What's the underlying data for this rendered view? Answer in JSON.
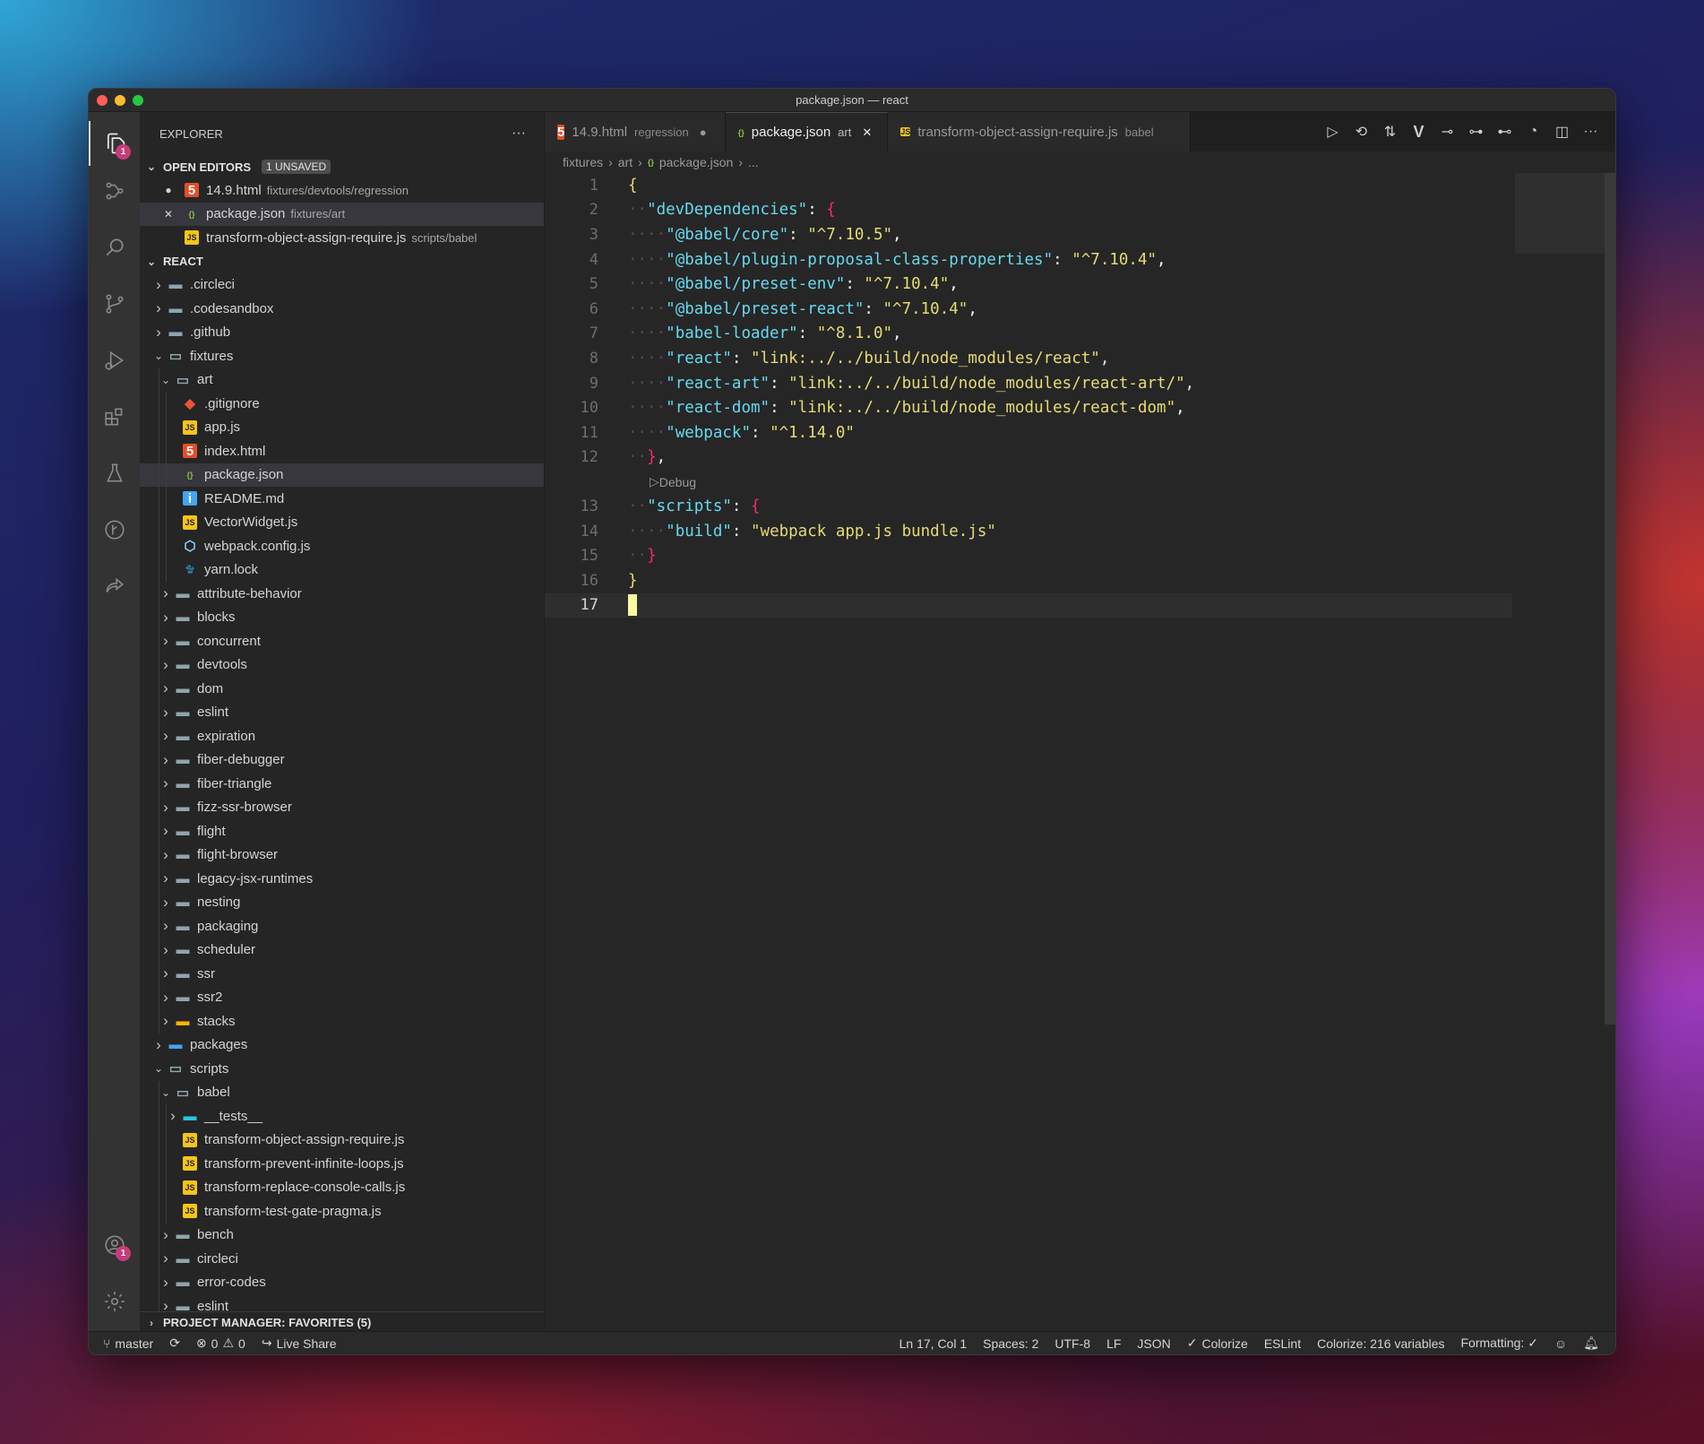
{
  "window": {
    "title": "package.json — react"
  },
  "sidebar": {
    "title": "EXPLORER",
    "more": "···",
    "open_editors": {
      "label": "OPEN EDITORS",
      "badge": "1 UNSAVED",
      "items": [
        {
          "name": "14.9.html",
          "desc": "fixtures/devtools/regression",
          "icon": "html5-icon",
          "state": "unsaved"
        },
        {
          "name": "package.json",
          "desc": "fixtures/art",
          "icon": "json-file-icon",
          "state": "close"
        },
        {
          "name": "transform-object-assign-require.js",
          "desc": "scripts/babel",
          "icon": "js-file-icon",
          "state": ""
        }
      ]
    },
    "react_label": "REACT",
    "tree": [
      {
        "name": ".circleci",
        "depth": 1,
        "type": "folder",
        "open": false,
        "icon": "circleci-folder-icon"
      },
      {
        "name": ".codesandbox",
        "depth": 1,
        "type": "folder",
        "open": false,
        "icon": "folder-icon"
      },
      {
        "name": ".github",
        "depth": 1,
        "type": "folder",
        "open": false,
        "icon": "github-folder-icon"
      },
      {
        "name": "fixtures",
        "depth": 1,
        "type": "folder",
        "open": true,
        "icon": "folder-open-icon"
      },
      {
        "name": "art",
        "depth": 2,
        "type": "folder",
        "open": true,
        "icon": "folder-open-icon"
      },
      {
        "name": ".gitignore",
        "depth": 3,
        "type": "file",
        "icon": "git-icon"
      },
      {
        "name": "app.js",
        "depth": 3,
        "type": "file",
        "icon": "js-file-icon"
      },
      {
        "name": "index.html",
        "depth": 3,
        "type": "file",
        "icon": "html5-icon"
      },
      {
        "name": "package.json",
        "depth": 3,
        "type": "file",
        "icon": "json-file-icon",
        "selected": true
      },
      {
        "name": "README.md",
        "depth": 3,
        "type": "file",
        "icon": "info-icon"
      },
      {
        "name": "VectorWidget.js",
        "depth": 3,
        "type": "file",
        "icon": "js-file-icon"
      },
      {
        "name": "webpack.config.js",
        "depth": 3,
        "type": "file",
        "icon": "webpack-icon"
      },
      {
        "name": "yarn.lock",
        "depth": 3,
        "type": "file",
        "icon": "yarn-icon"
      },
      {
        "name": "attribute-behavior",
        "depth": 2,
        "type": "folder",
        "open": false,
        "icon": "folder-icon"
      },
      {
        "name": "blocks",
        "depth": 2,
        "type": "folder",
        "open": false,
        "icon": "folder-icon"
      },
      {
        "name": "concurrent",
        "depth": 2,
        "type": "folder",
        "open": false,
        "icon": "folder-icon"
      },
      {
        "name": "devtools",
        "depth": 2,
        "type": "folder",
        "open": false,
        "icon": "folder-icon"
      },
      {
        "name": "dom",
        "depth": 2,
        "type": "folder",
        "open": false,
        "icon": "folder-icon"
      },
      {
        "name": "eslint",
        "depth": 2,
        "type": "folder",
        "open": false,
        "icon": "folder-icon"
      },
      {
        "name": "expiration",
        "depth": 2,
        "type": "folder",
        "open": false,
        "icon": "folder-icon"
      },
      {
        "name": "fiber-debugger",
        "depth": 2,
        "type": "folder",
        "open": false,
        "icon": "folder-icon"
      },
      {
        "name": "fiber-triangle",
        "depth": 2,
        "type": "folder",
        "open": false,
        "icon": "folder-icon"
      },
      {
        "name": "fizz-ssr-browser",
        "depth": 2,
        "type": "folder",
        "open": false,
        "icon": "folder-icon"
      },
      {
        "name": "flight",
        "depth": 2,
        "type": "folder",
        "open": false,
        "icon": "folder-icon"
      },
      {
        "name": "flight-browser",
        "depth": 2,
        "type": "folder",
        "open": false,
        "icon": "folder-icon"
      },
      {
        "name": "legacy-jsx-runtimes",
        "depth": 2,
        "type": "folder",
        "open": false,
        "icon": "folder-icon"
      },
      {
        "name": "nesting",
        "depth": 2,
        "type": "folder",
        "open": false,
        "icon": "folder-icon"
      },
      {
        "name": "packaging",
        "depth": 2,
        "type": "folder",
        "open": false,
        "icon": "folder-icon"
      },
      {
        "name": "scheduler",
        "depth": 2,
        "type": "folder",
        "open": false,
        "icon": "folder-icon"
      },
      {
        "name": "ssr",
        "depth": 2,
        "type": "folder",
        "open": false,
        "icon": "folder-icon"
      },
      {
        "name": "ssr2",
        "depth": 2,
        "type": "folder",
        "open": false,
        "icon": "folder-icon"
      },
      {
        "name": "stacks",
        "depth": 2,
        "type": "folder",
        "open": false,
        "icon": "folder-yellow-icon"
      },
      {
        "name": "packages",
        "depth": 1,
        "type": "folder",
        "open": false,
        "icon": "folder-blue-icon"
      },
      {
        "name": "scripts",
        "depth": 1,
        "type": "folder",
        "open": true,
        "icon": "folder-open-icon"
      },
      {
        "name": "babel",
        "depth": 2,
        "type": "folder",
        "open": true,
        "icon": "folder-open-icon"
      },
      {
        "name": "__tests__",
        "depth": 3,
        "type": "folder",
        "open": false,
        "icon": "folder-teal-icon"
      },
      {
        "name": "transform-object-assign-require.js",
        "depth": 3,
        "type": "file",
        "icon": "js-file-icon"
      },
      {
        "name": "transform-prevent-infinite-loops.js",
        "depth": 3,
        "type": "file",
        "icon": "js-file-icon"
      },
      {
        "name": "transform-replace-console-calls.js",
        "depth": 3,
        "type": "file",
        "icon": "js-file-icon"
      },
      {
        "name": "transform-test-gate-pragma.js",
        "depth": 3,
        "type": "file",
        "icon": "js-file-icon"
      },
      {
        "name": "bench",
        "depth": 2,
        "type": "folder",
        "open": false,
        "icon": "folder-icon"
      },
      {
        "name": "circleci",
        "depth": 2,
        "type": "folder",
        "open": false,
        "icon": "folder-icon"
      },
      {
        "name": "error-codes",
        "depth": 2,
        "type": "folder",
        "open": false,
        "icon": "folder-icon"
      },
      {
        "name": "eslint",
        "depth": 2,
        "type": "folder",
        "open": false,
        "icon": "folder-icon"
      }
    ],
    "project_manager": "PROJECT MANAGER: FAVORITES (5)"
  },
  "activity": {
    "explorer_badge": "1",
    "accounts_badge": "1"
  },
  "tabs": [
    {
      "name": "14.9.html",
      "desc": "regression",
      "icon": "html5-icon",
      "state": "unsaved",
      "active": false
    },
    {
      "name": "package.json",
      "desc": "art",
      "icon": "json-file-icon",
      "state": "close",
      "active": true
    },
    {
      "name": "transform-object-assign-require.js",
      "desc": "babel",
      "icon": "js-file-icon",
      "state": "",
      "active": false
    }
  ],
  "tab_actions": [
    "run-icon",
    "history-icon",
    "compare-icon",
    "vim-icon",
    "commit-icon",
    "previous-change-icon",
    "next-change-icon",
    "timeline-icon",
    "split-editor-icon",
    "more-icon"
  ],
  "tab_actions_text": {
    "vim": "V",
    "more": "···"
  },
  "breadcrumb": [
    "fixtures",
    "art",
    "package.json",
    "..."
  ],
  "code": {
    "current_line": 17,
    "codelens": "Debug",
    "lines": [
      [
        [
          "b1",
          "{"
        ]
      ],
      [
        [
          "k",
          "\"devDependencies\""
        ],
        [
          "p",
          ": "
        ],
        [
          "b2",
          "{"
        ]
      ],
      [
        [
          "k",
          "\"@babel/core\""
        ],
        [
          "p",
          ": "
        ],
        [
          "s",
          "\"^7.10.5\""
        ],
        [
          "p",
          ","
        ]
      ],
      [
        [
          "k",
          "\"@babel/plugin-proposal-class-properties\""
        ],
        [
          "p",
          ": "
        ],
        [
          "s",
          "\"^7.10.4\""
        ],
        [
          "p",
          ","
        ]
      ],
      [
        [
          "k",
          "\"@babel/preset-env\""
        ],
        [
          "p",
          ": "
        ],
        [
          "s",
          "\"^7.10.4\""
        ],
        [
          "p",
          ","
        ]
      ],
      [
        [
          "k",
          "\"@babel/preset-react\""
        ],
        [
          "p",
          ": "
        ],
        [
          "s",
          "\"^7.10.4\""
        ],
        [
          "p",
          ","
        ]
      ],
      [
        [
          "k",
          "\"babel-loader\""
        ],
        [
          "p",
          ": "
        ],
        [
          "s",
          "\"^8.1.0\""
        ],
        [
          "p",
          ","
        ]
      ],
      [
        [
          "k",
          "\"react\""
        ],
        [
          "p",
          ": "
        ],
        [
          "s",
          "\"link:../../build/node_modules/react\""
        ],
        [
          "p",
          ","
        ]
      ],
      [
        [
          "k",
          "\"react-art\""
        ],
        [
          "p",
          ": "
        ],
        [
          "s",
          "\"link:../../build/node_modules/react-art/\""
        ],
        [
          "p",
          ","
        ]
      ],
      [
        [
          "k",
          "\"react-dom\""
        ],
        [
          "p",
          ": "
        ],
        [
          "s",
          "\"link:../../build/node_modules/react-dom\""
        ],
        [
          "p",
          ","
        ]
      ],
      [
        [
          "k",
          "\"webpack\""
        ],
        [
          "p",
          ": "
        ],
        [
          "s",
          "\"^1.14.0\""
        ]
      ],
      [
        [
          "b2",
          "}"
        ],
        [
          "p",
          ","
        ]
      ],
      [
        [
          "k",
          "\"scripts\""
        ],
        [
          "p",
          ": "
        ],
        [
          "b2",
          "{"
        ]
      ],
      [
        [
          "k",
          "\"build\""
        ],
        [
          "p",
          ": "
        ],
        [
          "s",
          "\"webpack app.js bundle.js\""
        ]
      ],
      [
        [
          "b2",
          "}"
        ]
      ],
      [
        [
          "b1",
          "}"
        ]
      ],
      []
    ],
    "indent": [
      0,
      1,
      2,
      2,
      2,
      2,
      2,
      2,
      2,
      2,
      2,
      1,
      1,
      2,
      1,
      0,
      0
    ]
  },
  "statusbar": {
    "branch": "master",
    "errors": "0",
    "warnings": "0",
    "live_share": "Live Share",
    "position": "Ln 17, Col 1",
    "spaces": "Spaces: 2",
    "encoding": "UTF-8",
    "eol": "LF",
    "language": "JSON",
    "colorize": "Colorize",
    "eslint": "ESLint",
    "colorize_vars": "Colorize: 216 variables",
    "formatting": "Formatting: ✓"
  }
}
